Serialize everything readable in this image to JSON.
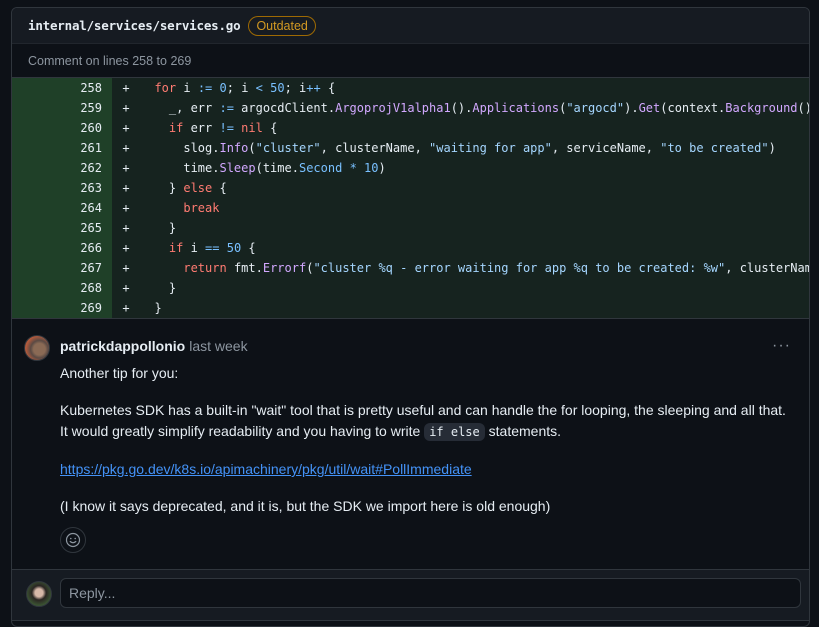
{
  "file": {
    "path": "internal/services/services.go",
    "badge": "Outdated",
    "comment_range": "Comment on lines 258 to 269"
  },
  "diff": {
    "lines": [
      {
        "num": "258",
        "sign": "+",
        "tokens": [
          [
            "",
            "  "
          ],
          [
            "kw",
            "for"
          ],
          [
            "",
            " i "
          ],
          [
            "op",
            ":="
          ],
          [
            "",
            " "
          ],
          [
            "num",
            "0"
          ],
          [
            "",
            "; i "
          ],
          [
            "op",
            "<"
          ],
          [
            "",
            " "
          ],
          [
            "num",
            "50"
          ],
          [
            "",
            "; i"
          ],
          [
            "op",
            "++"
          ],
          [
            "",
            " {"
          ]
        ]
      },
      {
        "num": "259",
        "sign": "+",
        "tokens": [
          [
            "",
            "    _, err "
          ],
          [
            "op",
            ":="
          ],
          [
            "",
            " argocdClient."
          ],
          [
            "fn",
            "ArgoprojV1alpha1"
          ],
          [
            "",
            "()."
          ],
          [
            "fn",
            "Applications"
          ],
          [
            "",
            "("
          ],
          [
            "str",
            "\"argocd\""
          ],
          [
            "",
            ")."
          ],
          [
            "fn",
            "Get"
          ],
          [
            "",
            "(context."
          ],
          [
            "fn",
            "Background"
          ],
          [
            "",
            "(),"
          ]
        ]
      },
      {
        "num": "260",
        "sign": "+",
        "tokens": [
          [
            "",
            "    "
          ],
          [
            "kw",
            "if"
          ],
          [
            "",
            " err "
          ],
          [
            "op",
            "!="
          ],
          [
            "",
            " "
          ],
          [
            "kw",
            "nil"
          ],
          [
            "",
            " {"
          ]
        ]
      },
      {
        "num": "261",
        "sign": "+",
        "tokens": [
          [
            "",
            "      slog."
          ],
          [
            "fn",
            "Info"
          ],
          [
            "",
            "("
          ],
          [
            "str",
            "\"cluster\""
          ],
          [
            "",
            ", clusterName, "
          ],
          [
            "str",
            "\"waiting for app\""
          ],
          [
            "",
            ", serviceName, "
          ],
          [
            "str",
            "\"to be created\""
          ],
          [
            "",
            ")"
          ]
        ]
      },
      {
        "num": "262",
        "sign": "+",
        "tokens": [
          [
            "",
            "      time."
          ],
          [
            "fn",
            "Sleep"
          ],
          [
            "",
            "(time."
          ],
          [
            "num",
            "Second"
          ],
          [
            "",
            " "
          ],
          [
            "op",
            "*"
          ],
          [
            "",
            " "
          ],
          [
            "num",
            "10"
          ],
          [
            "",
            ")"
          ]
        ]
      },
      {
        "num": "263",
        "sign": "+",
        "tokens": [
          [
            "",
            "    } "
          ],
          [
            "kw",
            "else"
          ],
          [
            "",
            " {"
          ]
        ]
      },
      {
        "num": "264",
        "sign": "+",
        "tokens": [
          [
            "",
            "      "
          ],
          [
            "kw",
            "break"
          ]
        ]
      },
      {
        "num": "265",
        "sign": "+",
        "tokens": [
          [
            "",
            "    }"
          ]
        ]
      },
      {
        "num": "266",
        "sign": "+",
        "tokens": [
          [
            "",
            "    "
          ],
          [
            "kw",
            "if"
          ],
          [
            "",
            " i "
          ],
          [
            "op",
            "=="
          ],
          [
            "",
            " "
          ],
          [
            "num",
            "50"
          ],
          [
            "",
            " {"
          ]
        ]
      },
      {
        "num": "267",
        "sign": "+",
        "tokens": [
          [
            "",
            "      "
          ],
          [
            "kw",
            "return"
          ],
          [
            "",
            " fmt."
          ],
          [
            "fn",
            "Errorf"
          ],
          [
            "",
            "("
          ],
          [
            "str",
            "\"cluster %q - error waiting for app %q to be created: %w\""
          ],
          [
            "",
            ", clusterName"
          ]
        ]
      },
      {
        "num": "268",
        "sign": "+",
        "tokens": [
          [
            "",
            "    }"
          ]
        ]
      },
      {
        "num": "269",
        "sign": "+",
        "tokens": [
          [
            "",
            "  }"
          ]
        ]
      }
    ]
  },
  "comment": {
    "author": "patrickdappollonio",
    "timestamp": "last week",
    "more_icon": "kebab-horizontal-icon",
    "paragraph1": "Another tip for you:",
    "paragraph2_before": "Kubernetes SDK has a built-in \"wait\" tool that is pretty useful and can handle the for looping, the sleeping and all that. It would greatly simplify readability and you having to write ",
    "paragraph2_code": "if else",
    "paragraph2_after": " statements.",
    "link": "https://pkg.go.dev/k8s.io/apimachinery/pkg/util/wait#PollImmediate",
    "paragraph4": "(I know it says deprecated, and it is, but the SDK we import here is old enough)",
    "reaction_icon": "smiley-icon"
  },
  "reply": {
    "placeholder": "Reply..."
  }
}
